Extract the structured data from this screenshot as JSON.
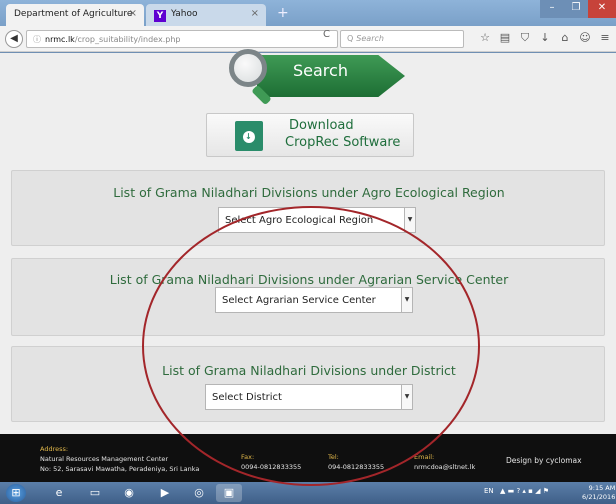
{
  "browser": {
    "tabs": [
      {
        "title": "Department of Agriculture",
        "close": "×"
      },
      {
        "title": "Yahoo",
        "icon": "Y",
        "close": "×"
      }
    ],
    "new_tab": "+",
    "window_buttons": {
      "minimize": "–",
      "maximize": "❐",
      "close": "✕"
    },
    "url": {
      "info_icon": "ⓘ",
      "host": "nrmc.lk",
      "path": "/crop_suitability/index.php"
    },
    "reload_icon": "C",
    "search_placeholder": "Search",
    "search_icon": "Q"
  },
  "page": {
    "search_banner": "Search",
    "download": {
      "line1": "Download",
      "line2": "CropRec Software"
    },
    "sections": [
      {
        "title": "List of Grama Niladhari Divisions under Agro Ecological Region",
        "select": "Select Agro Ecological Region"
      },
      {
        "title": "List of Grama Niladhari Divisions under Agrarian Service Center",
        "select": "Select Agrarian Service Center"
      },
      {
        "title": "List of Grama Niladhari Divisions under District",
        "select": "Select District"
      }
    ]
  },
  "footer": {
    "address_label": "Address:",
    "address_line1": "Natural Resources Management Center",
    "address_line2": "No: 52, Sarasavi Mawatha, Peradeniya, Sri Lanka",
    "fax_label": "Fax:",
    "fax": "0094-0812833355",
    "tel_label": "Tel:",
    "tel": "094-0812833355",
    "email_label": "Email:",
    "email": "nrmcdoa@sltnet.lk",
    "credit": "Design by cyclomax"
  },
  "taskbar": {
    "lang": "EN",
    "time": "9:15 AM",
    "date": "6/21/2016"
  },
  "colors": {
    "accent_green": "#1f6e3c",
    "annotation_red": "#a3262a"
  }
}
